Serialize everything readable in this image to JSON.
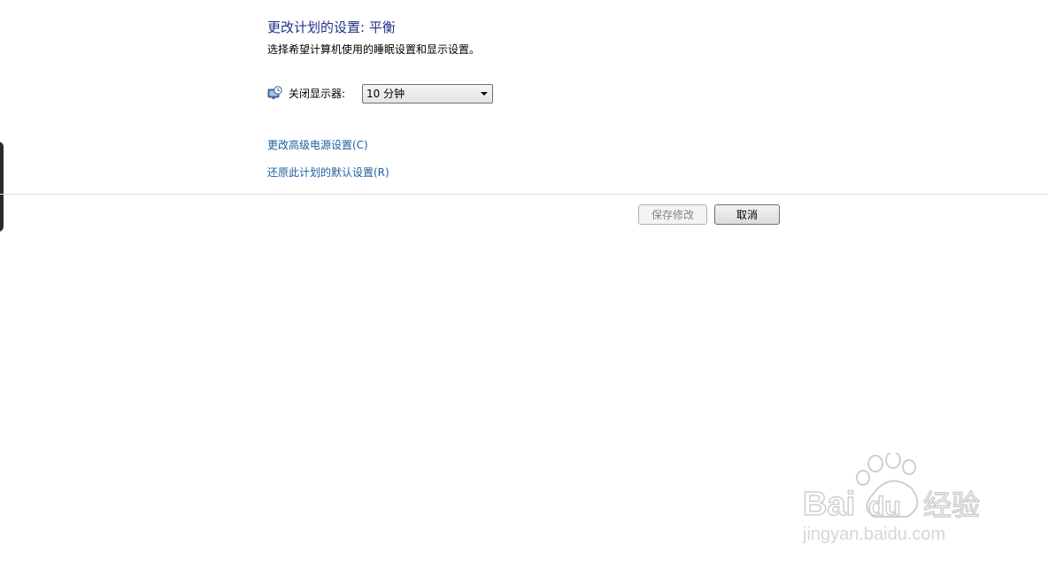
{
  "header": {
    "title": "更改计划的设置: 平衡",
    "subtitle": "选择希望计算机使用的睡眠设置和显示设置。"
  },
  "settings": {
    "display_off": {
      "label": "关闭显示器:",
      "icon": "monitor-clock-icon",
      "selected": "10 分钟"
    }
  },
  "links": {
    "advanced": "更改高级电源设置(C)",
    "restore": "还原此计划的默认设置(R)"
  },
  "buttons": {
    "save": "保存修改",
    "cancel": "取消"
  },
  "watermark": {
    "icon": "baidu-paw-logo",
    "brand_text": "Baidu经验",
    "url": "jingyan.baidu.com"
  },
  "colors": {
    "title": "#1e3287",
    "link": "#1e5fa0",
    "disabled_text": "#838383"
  }
}
